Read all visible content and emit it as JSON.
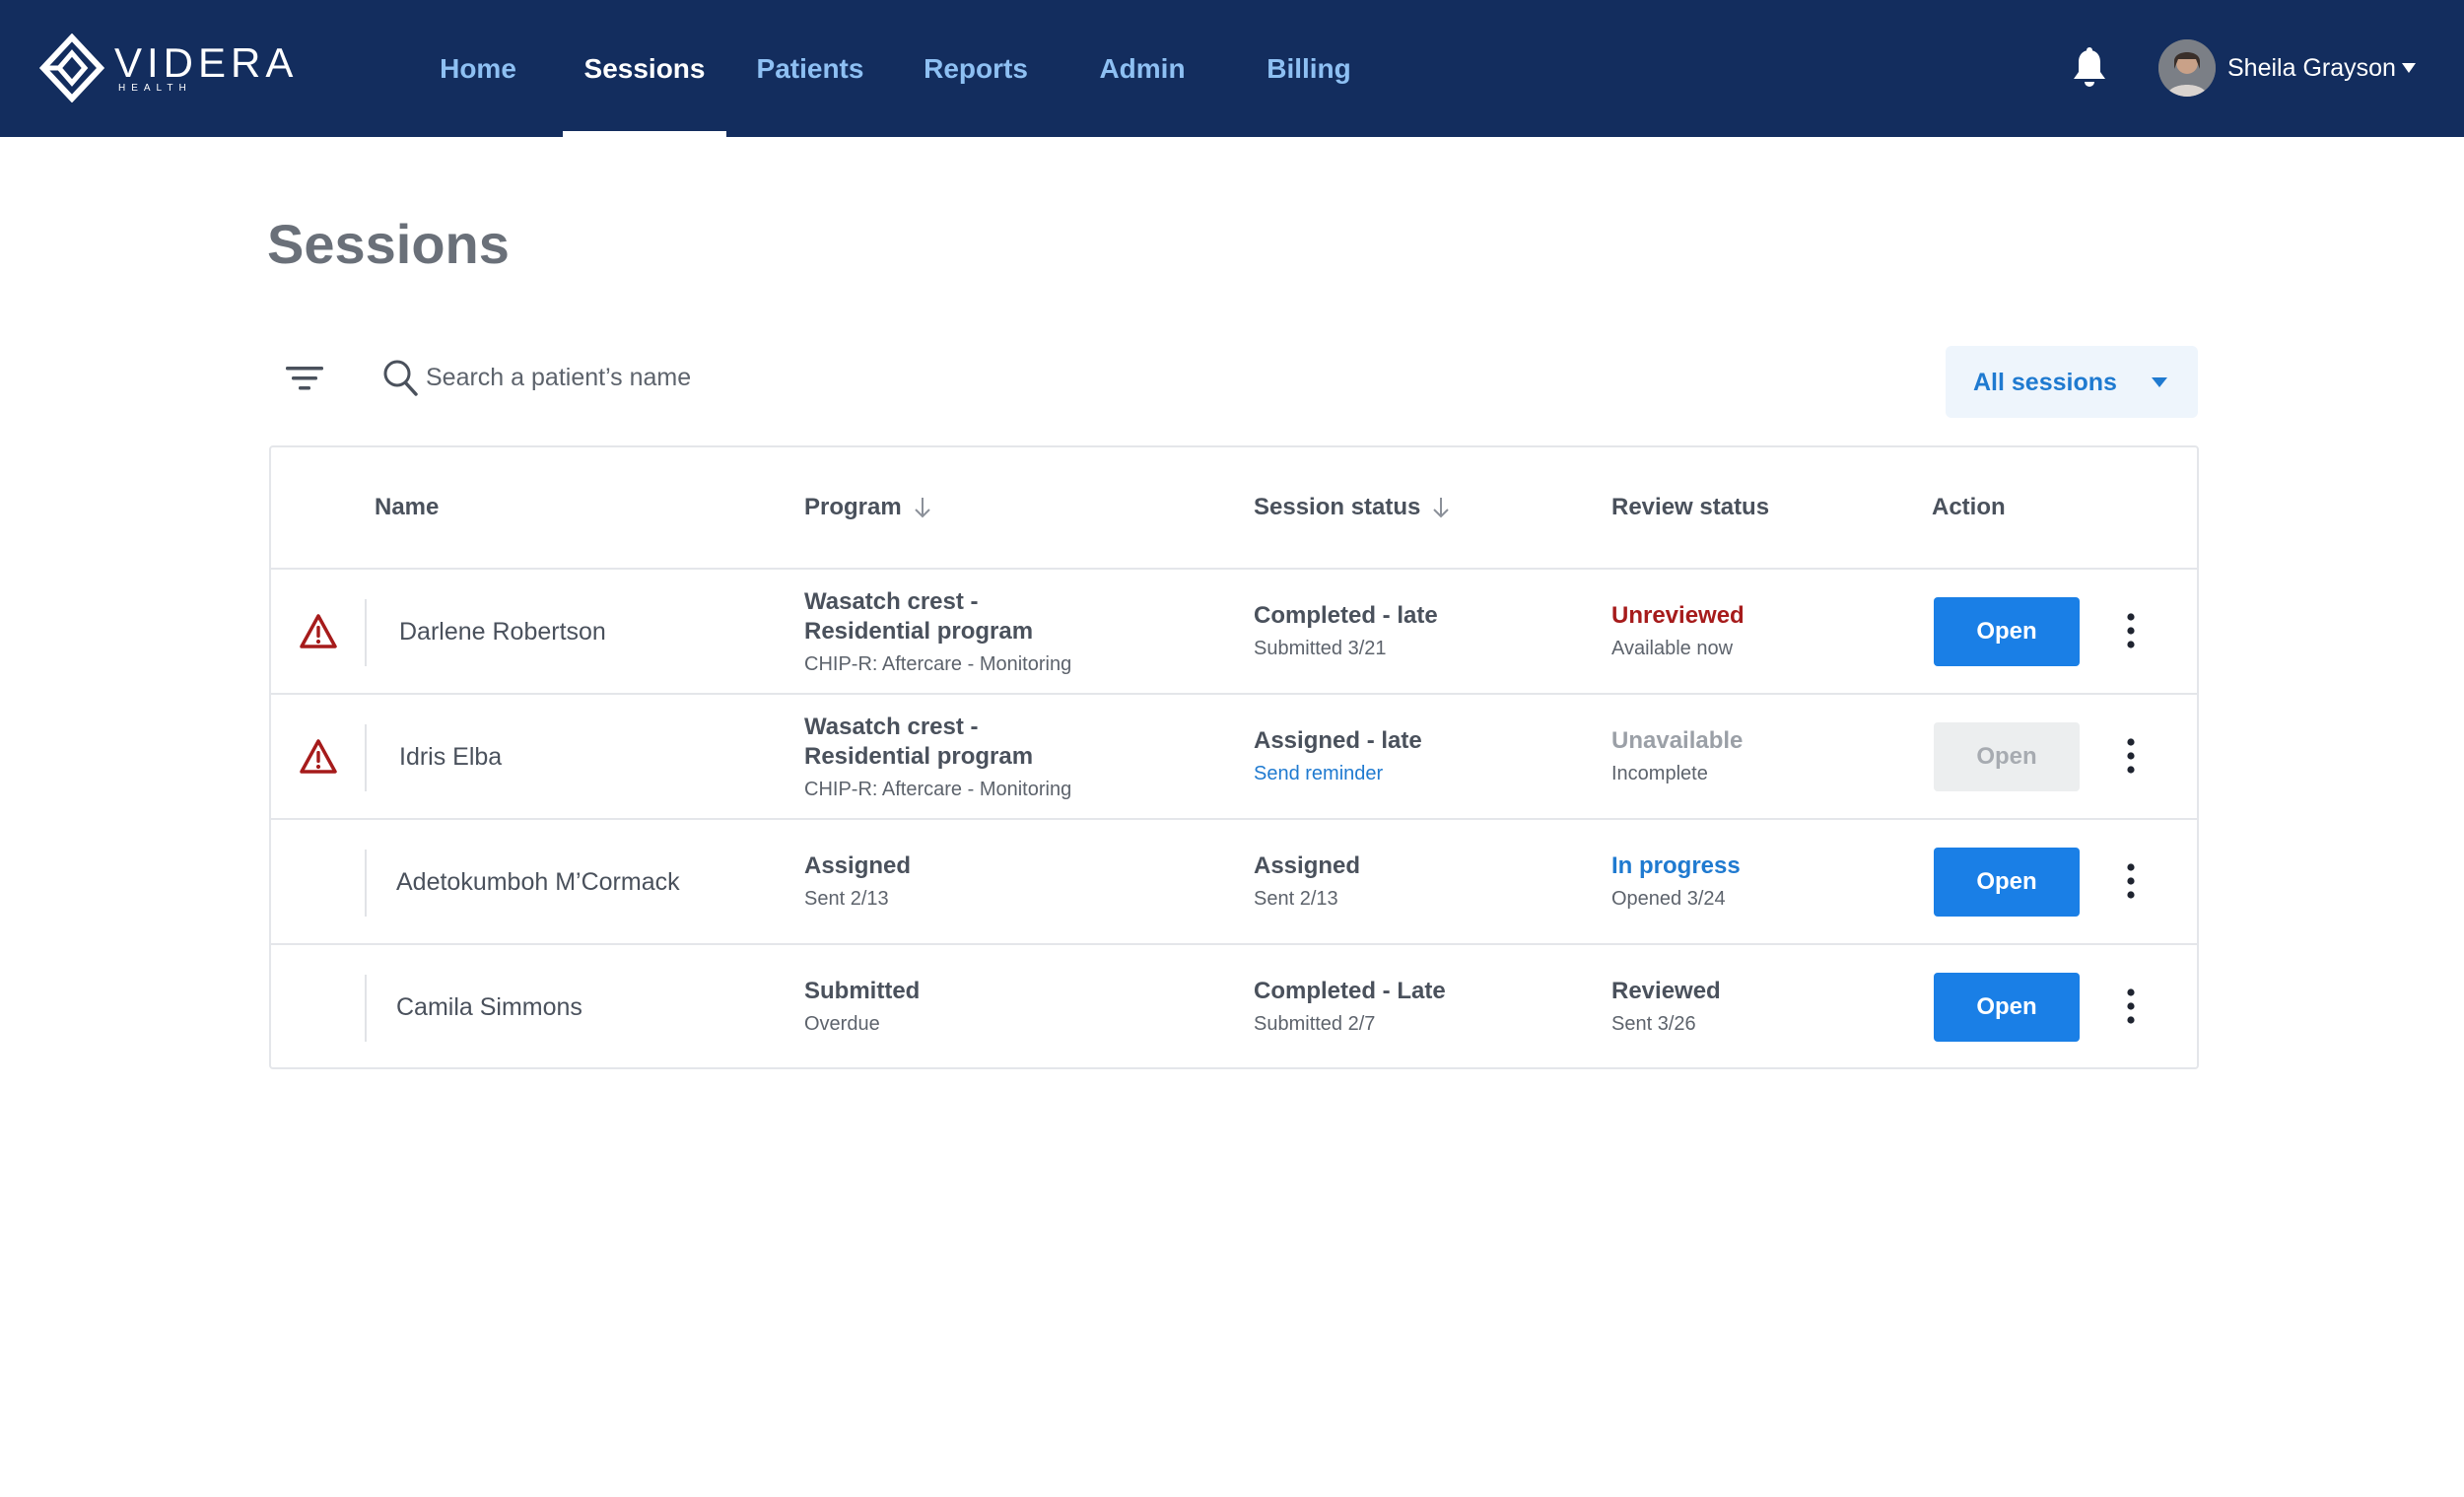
{
  "brand": {
    "name": "VIDERA",
    "sub": "HEALTH"
  },
  "nav": {
    "items": [
      {
        "label": "Home"
      },
      {
        "label": "Sessions"
      },
      {
        "label": "Patients"
      },
      {
        "label": "Reports"
      },
      {
        "label": "Admin"
      },
      {
        "label": "Billing"
      }
    ],
    "active": "Sessions"
  },
  "user": {
    "name": "Sheila Grayson"
  },
  "page": {
    "title": "Sessions"
  },
  "toolbar": {
    "search_placeholder": "Search a patient’s name",
    "filter_select": "All sessions"
  },
  "table": {
    "headers": {
      "name": "Name",
      "program": "Program",
      "session_status": "Session status",
      "review_status": "Review status",
      "action": "Action"
    },
    "rows": [
      {
        "alert": true,
        "name": "Darlene Robertson",
        "program_primary": "Wasatch crest - Residential program",
        "program_secondary": "CHIP-R: Aftercare - Monitoring",
        "session_primary": "Completed - late",
        "session_secondary": "Submitted 3/21",
        "review_primary": "Unreviewed",
        "review_secondary": "Available now",
        "review_state": "unreviewed",
        "action_label": "Open",
        "action_enabled": true
      },
      {
        "alert": true,
        "name": "Idris Elba",
        "program_primary": "Wasatch crest - Residential program",
        "program_secondary": "CHIP-R: Aftercare - Monitoring",
        "session_primary": "Assigned - late",
        "session_secondary": "Send reminder",
        "review_primary": "Unavailable",
        "review_secondary": "Incomplete",
        "review_state": "unavailable",
        "action_label": "Open",
        "action_enabled": false
      },
      {
        "alert": false,
        "name": "Adetokumboh M’Cormack",
        "program_primary": "Assigned",
        "program_secondary": "Sent 2/13",
        "session_primary": "Assigned",
        "session_secondary": "Sent 2/13",
        "review_primary": "In progress",
        "review_secondary": "Opened 3/24",
        "review_state": "in-progress",
        "action_label": "Open",
        "action_enabled": true
      },
      {
        "alert": false,
        "name": "Camila Simmons",
        "program_primary": "Submitted",
        "program_secondary": "Overdue",
        "session_primary": "Completed - Late",
        "session_secondary": "Submitted 2/7",
        "review_primary": "Reviewed",
        "review_secondary": "Sent 3/26",
        "review_state": "reviewed",
        "action_label": "Open",
        "action_enabled": true
      }
    ]
  },
  "colors": {
    "topbar": "#132d5e",
    "nav_link": "#8ec0f3",
    "primary_button": "#1a7fe6",
    "alert_red": "#a61b1b",
    "link_blue": "#1f7ad0"
  },
  "icons": [
    "logo-mark-icon",
    "bell-icon",
    "chevron-down-icon",
    "filter-icon",
    "search-icon",
    "warning-icon",
    "arrow-down-icon",
    "kebab-icon"
  ]
}
